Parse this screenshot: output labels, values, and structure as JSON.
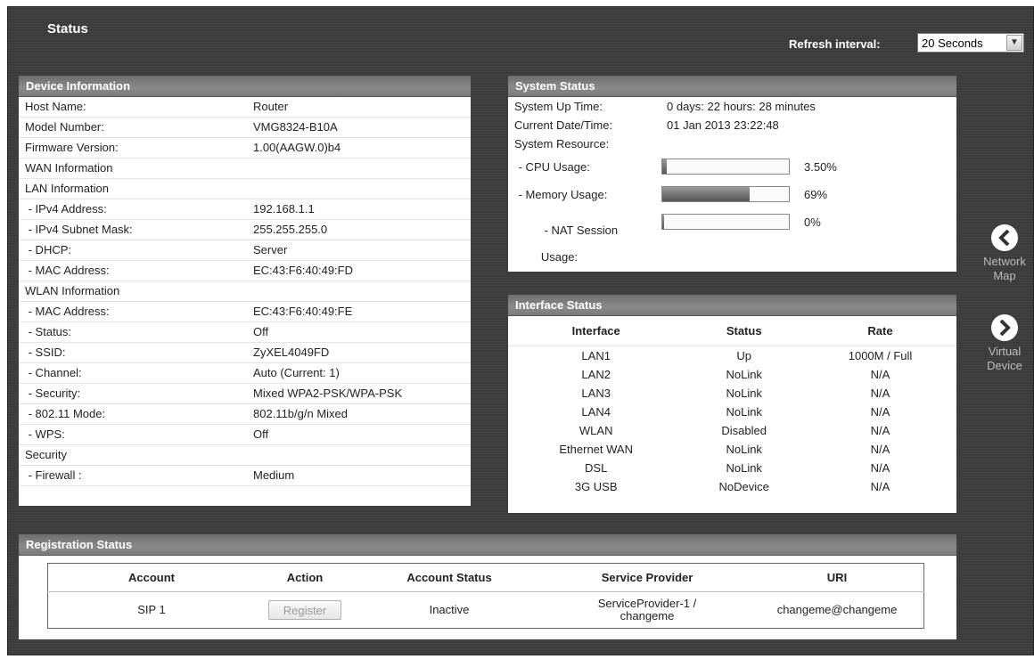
{
  "header": {
    "title": "Status",
    "refresh_label": "Refresh interval:",
    "refresh_value": "20 Seconds"
  },
  "device_info": {
    "title": "Device Information",
    "rows": [
      {
        "key": "Host Name:",
        "value": "Router"
      },
      {
        "key": "Model Number:",
        "value": "VMG8324-B10A"
      },
      {
        "key": "Firmware Version:",
        "value": "1.00(AAGW.0)b4"
      },
      {
        "key": "WAN Information",
        "value": ""
      },
      {
        "key": "LAN Information",
        "value": ""
      },
      {
        "key": " - IPv4 Address:",
        "value": "192.168.1.1"
      },
      {
        "key": " - IPv4 Subnet Mask:",
        "value": "255.255.255.0"
      },
      {
        "key": " - DHCP:",
        "value": "Server"
      },
      {
        "key": " - MAC Address:",
        "value": "EC:43:F6:40:49:FD"
      },
      {
        "key": "WLAN Information",
        "value": ""
      },
      {
        "key": " - MAC Address:",
        "value": "EC:43:F6:40:49:FE"
      },
      {
        "key": " - Status:",
        "value": "Off"
      },
      {
        "key": " - SSID:",
        "value": "ZyXEL4049FD"
      },
      {
        "key": " - Channel:",
        "value": "Auto (Current: 1)"
      },
      {
        "key": " - Security:",
        "value": "Mixed WPA2-PSK/WPA-PSK"
      },
      {
        "key": " - 802.11 Mode:",
        "value": "802.11b/g/n Mixed"
      },
      {
        "key": " - WPS:",
        "value": "Off"
      },
      {
        "key": "Security",
        "value": ""
      },
      {
        "key": " - Firewall :",
        "value": "Medium"
      }
    ]
  },
  "system_status": {
    "title": "System Status",
    "up_time_label": "System Up Time:",
    "up_time_value": "0 days: 22 hours: 28 minutes",
    "datetime_label": "Current Date/Time:",
    "datetime_value": "01 Jan 2013 23:22:48",
    "resource_label": "System Resource:",
    "cpu_label": " - CPU Usage:",
    "cpu_pct": "3.50%",
    "cpu_fraction": 0.035,
    "mem_label": " - Memory Usage:",
    "mem_pct": "69%",
    "mem_fraction": 0.69,
    "nat_label_line1": " - NAT Session",
    "nat_label_line2": "Usage:",
    "nat_pct": "0%",
    "nat_fraction": 0.0
  },
  "interface_status": {
    "title": "Interface Status",
    "columns": [
      "Interface",
      "Status",
      "Rate"
    ],
    "rows": [
      [
        "LAN1",
        "Up",
        "1000M / Full"
      ],
      [
        "LAN2",
        "NoLink",
        "N/A"
      ],
      [
        "LAN3",
        "NoLink",
        "N/A"
      ],
      [
        "LAN4",
        "NoLink",
        "N/A"
      ],
      [
        "WLAN",
        "Disabled",
        "N/A"
      ],
      [
        "Ethernet WAN",
        "NoLink",
        "N/A"
      ],
      [
        "DSL",
        "NoLink",
        "N/A"
      ],
      [
        "3G USB",
        "NoDevice",
        "N/A"
      ]
    ]
  },
  "registration_status": {
    "title": "Registration Status",
    "columns": [
      "Account",
      "Action",
      "Account Status",
      "Service Provider",
      "URI"
    ],
    "row": {
      "account": "SIP 1",
      "action_label": "Register",
      "status": "Inactive",
      "provider_line1": "ServiceProvider-1 /",
      "provider_line2": "changeme",
      "uri": "changeme@changeme"
    }
  },
  "side_nav": {
    "network_line1": "Network",
    "network_line2": "Map",
    "virtual_line1": "Virtual",
    "virtual_line2": "Device"
  },
  "colors": {
    "background": "#3c3c3c",
    "panel_header": "#7a7a7a",
    "bar_fill": "#555555"
  }
}
